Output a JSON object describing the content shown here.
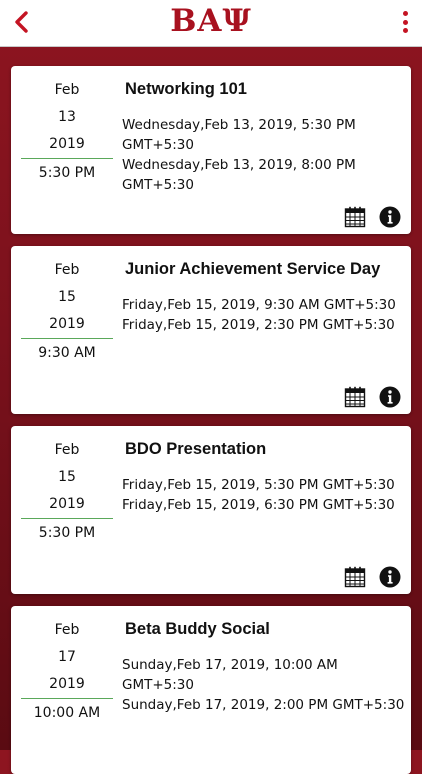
{
  "header": {
    "title": "ΒΑΨ",
    "back_icon": "chevron-left-icon",
    "menu_icon": "more-vertical-icon",
    "accent_color": "#c41423"
  },
  "events": [
    {
      "month": "Feb",
      "day": "13",
      "year": "2019",
      "time": "5:30 PM",
      "title": "Networking 101",
      "start": "Wednesday,Feb 13, 2019, 5:30 PM GMT+5:30",
      "end": "Wednesday,Feb 13, 2019, 8:00 PM GMT+5:30"
    },
    {
      "month": "Feb",
      "day": "15",
      "year": "2019",
      "time": "9:30 AM",
      "title": "Junior Achievement Service Day",
      "start": "Friday,Feb 15, 2019, 9:30 AM GMT+5:30",
      "end": "Friday,Feb 15, 2019, 2:30 PM GMT+5:30"
    },
    {
      "month": "Feb",
      "day": "15",
      "year": "2019",
      "time": "5:30 PM",
      "title": "BDO Presentation",
      "start": "Friday,Feb 15, 2019, 5:30 PM GMT+5:30",
      "end": "Friday,Feb 15, 2019, 6:30 PM GMT+5:30"
    },
    {
      "month": "Feb",
      "day": "17",
      "year": "2019",
      "time": "10:00 AM",
      "title": "Beta Buddy Social",
      "start": "Sunday,Feb 17, 2019, 10:00 AM GMT+5:30",
      "end": "Sunday,Feb 17, 2019, 2:00 PM GMT+5:30"
    }
  ]
}
